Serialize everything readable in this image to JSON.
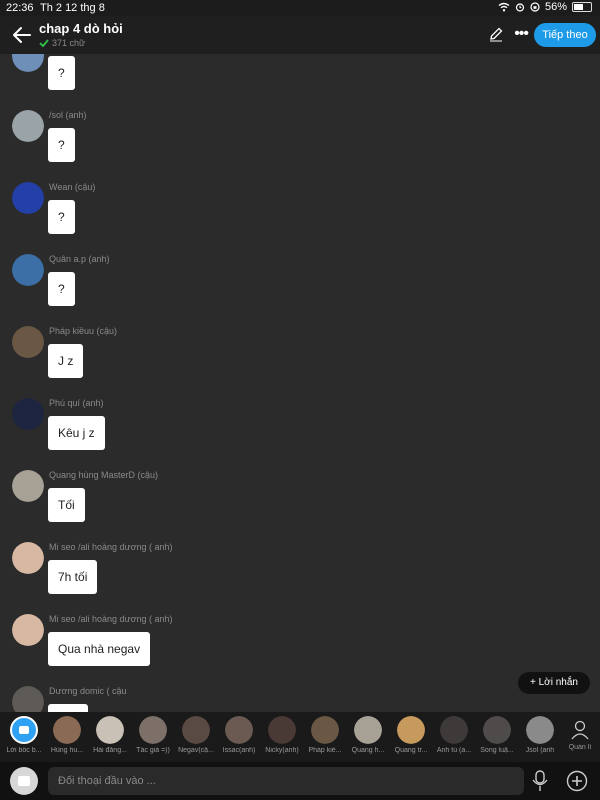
{
  "status": {
    "time": "22:36",
    "date": "Th 2 12 thg 8",
    "battery": "56%",
    "battery_level": 0.56
  },
  "header": {
    "title": "chap 4 dò hỏi",
    "subtitle": "371 chữ",
    "next_label": "Tiếp theo"
  },
  "messages": [
    {
      "sender": "",
      "text": "?",
      "avatar_color": "#6d8fb8"
    },
    {
      "sender": "/sol (anh)",
      "text": "?",
      "avatar_color": "#9aa4a8"
    },
    {
      "sender": "Wean (cậu)",
      "text": "?",
      "avatar_color": "#2340a8"
    },
    {
      "sender": "Quân a.p (anh)",
      "text": "?",
      "avatar_color": "#3b6fa5"
    },
    {
      "sender": "Pháp kiềuu (cậu)",
      "text": "J z",
      "avatar_color": "#6a5845"
    },
    {
      "sender": "Phú quí (anh)",
      "text": "Kêu j z",
      "avatar_color": "#1d2540"
    },
    {
      "sender": "Quang hùng MasterD (cậu)",
      "text": "Tối",
      "avatar_color": "#a8a296"
    },
    {
      "sender": "Mi seo /ali hoàng dương ( anh)",
      "text": "7h tối",
      "avatar_color": "#d7b9a3"
    },
    {
      "sender": "Mi seo /ali hoàng dương ( anh)",
      "text": "Qua nhà negav",
      "avatar_color": "#d7b9a3"
    },
    {
      "sender": "Dương domic ( cậu",
      "text": "",
      "avatar_color": "#5e5a55"
    }
  ],
  "add_message_label": "Lời nhắn",
  "characters": [
    {
      "name": "Lời bốc b...",
      "color": "#2ea1f3"
    },
    {
      "name": "Hùng hu...",
      "color": "#8a6a55"
    },
    {
      "name": "Hải đăng...",
      "color": "#c9c0b6"
    },
    {
      "name": "Tác giả =))",
      "color": "#7d7068"
    },
    {
      "name": "Negav(cậ...",
      "color": "#5a4a44"
    },
    {
      "name": "Issac(anh)",
      "color": "#6b5a52"
    },
    {
      "name": "Nicky(anh)",
      "color": "#4a3a35"
    },
    {
      "name": "Pháp kiề...",
      "color": "#6a5845"
    },
    {
      "name": "Quang h...",
      "color": "#a8a296"
    },
    {
      "name": "Quang tr...",
      "color": "#c69a5c"
    },
    {
      "name": "Anh tú (a...",
      "color": "#3e3a39"
    },
    {
      "name": "Song luậ...",
      "color": "#4f4b4a"
    },
    {
      "name": "Jsol (anh",
      "color": "#8a8a8a"
    }
  ],
  "manage_label": "Quản lí",
  "input": {
    "placeholder": "Đối thoại đầu vào ..."
  }
}
